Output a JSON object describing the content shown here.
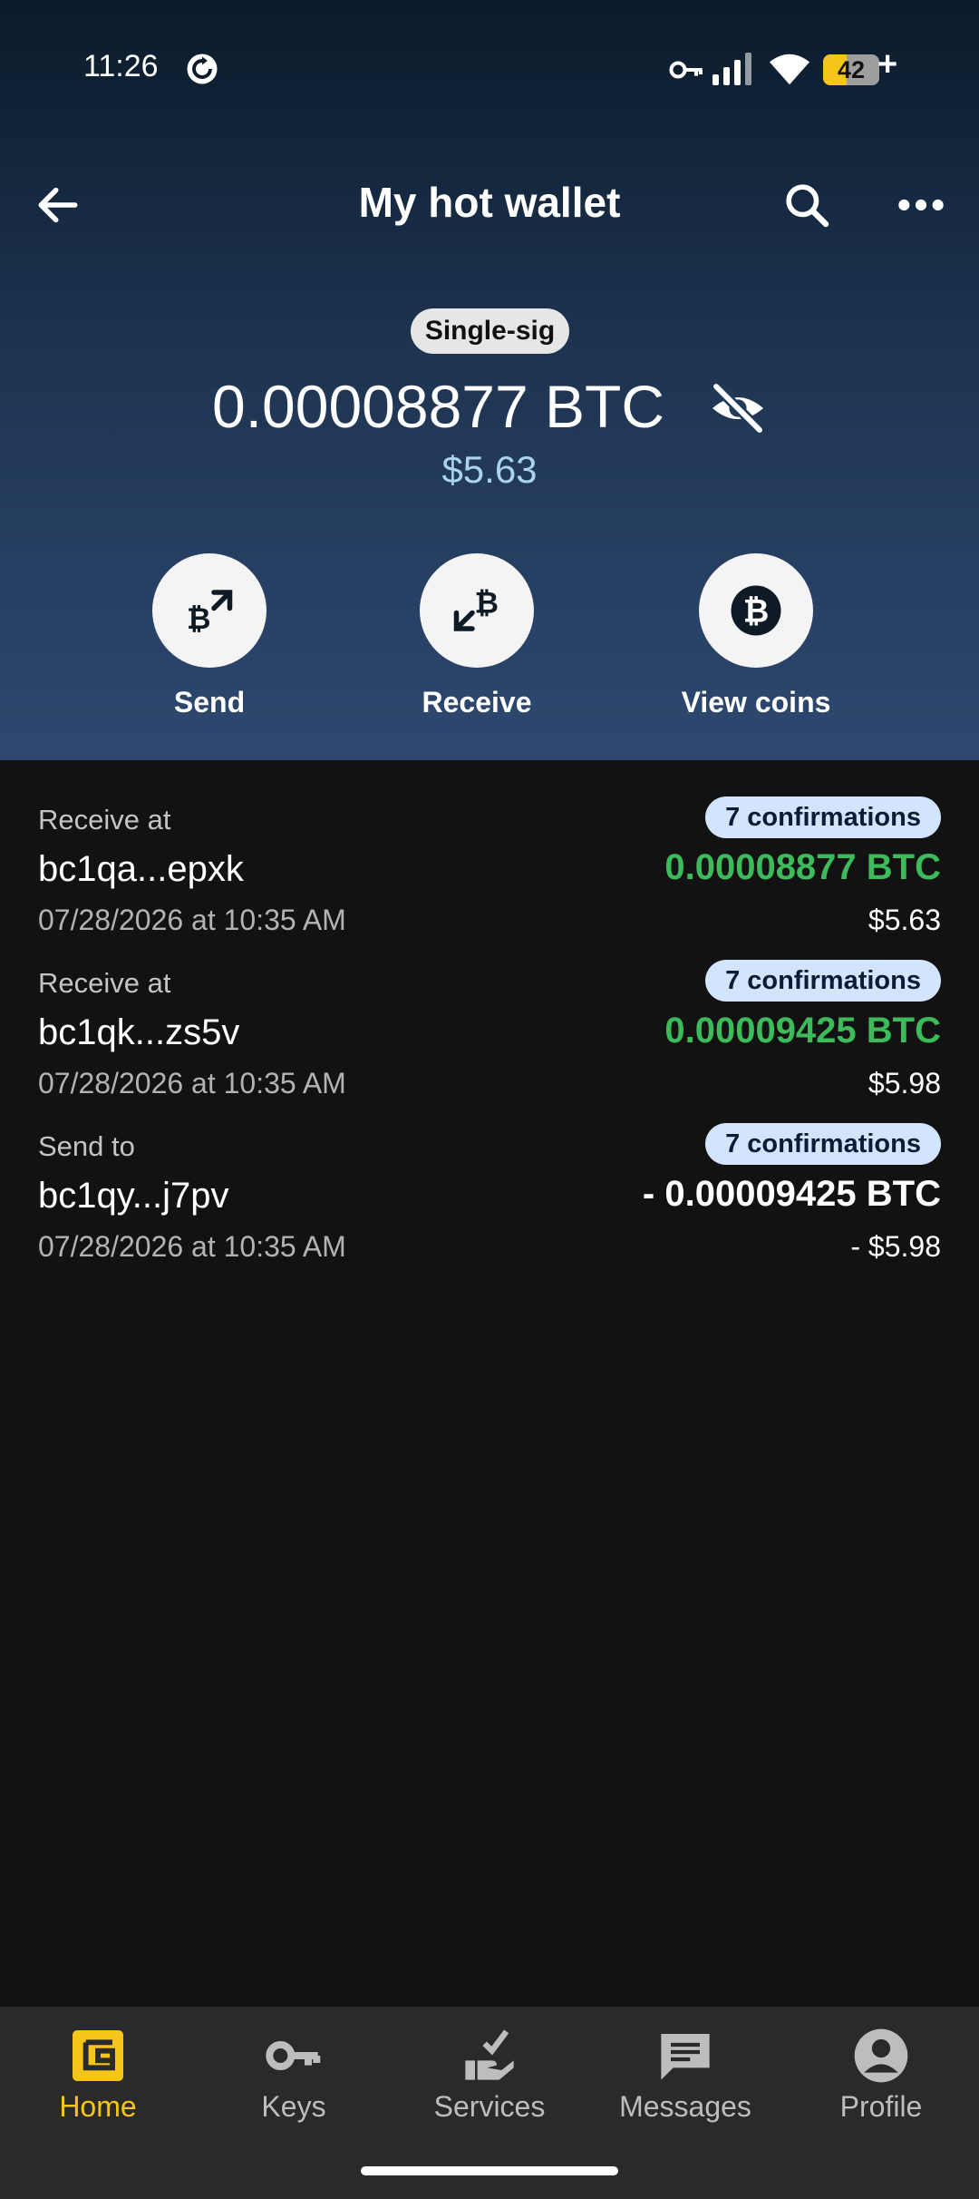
{
  "status_bar": {
    "time": "11:26",
    "battery": "42",
    "battery_level": 0.42
  },
  "app_bar": {
    "title": "My hot wallet"
  },
  "wallet": {
    "type_badge": "Single-sig",
    "balance": "0.00008877 BTC",
    "balance_fiat": "$5.63"
  },
  "actions": {
    "send": "Send",
    "receive": "Receive",
    "view_coins": "View coins"
  },
  "transactions": [
    {
      "type": "Receive at",
      "address": "bc1qa...epxk",
      "date": "07/28/2026 at 10:35 AM",
      "confirmations": "7 confirmations",
      "amount": "0.00008877 BTC",
      "fiat": "$5.63",
      "direction": "in"
    },
    {
      "type": "Receive at",
      "address": "bc1qk...zs5v",
      "date": "07/28/2026 at 10:35 AM",
      "confirmations": "7 confirmations",
      "amount": "0.00009425 BTC",
      "fiat": "$5.98",
      "direction": "in"
    },
    {
      "type": "Send to",
      "address": "bc1qy...j7pv",
      "date": "07/28/2026 at 10:35 AM",
      "confirmations": "7 confirmations",
      "amount": "- 0.00009425 BTC",
      "fiat": "- $5.98",
      "direction": "out"
    }
  ],
  "colors": {
    "incoming": "#3dbb5a",
    "outgoing": "#ffffff",
    "accent": "#f5c518"
  },
  "bottom_nav": [
    {
      "label": "Home",
      "icon": "wallet-icon",
      "active": true
    },
    {
      "label": "Keys",
      "icon": "key-icon",
      "active": false
    },
    {
      "label": "Services",
      "icon": "services-icon",
      "active": false
    },
    {
      "label": "Messages",
      "icon": "message-icon",
      "active": false
    },
    {
      "label": "Profile",
      "icon": "profile-icon",
      "active": false
    }
  ]
}
